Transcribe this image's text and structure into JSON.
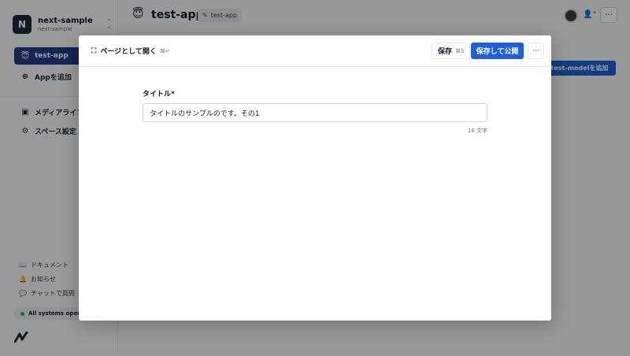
{
  "workspace": {
    "logo_letter": "N",
    "name": "next-sample",
    "subdomain": "next-sample"
  },
  "sidebar": {
    "apps": [
      {
        "label": "test-app",
        "icon": "😇",
        "active": true
      },
      {
        "label": "Appを追加",
        "icon": "⊕"
      }
    ],
    "tools": [
      {
        "label": "メディアライブラリ",
        "icon": "▣"
      },
      {
        "label": "スペース設定",
        "icon": "⚙"
      }
    ],
    "footer": [
      {
        "label": "ドキュメント",
        "icon": "📖"
      },
      {
        "label": "お知らせ",
        "icon": "🔔"
      },
      {
        "label": "チャットで質問",
        "icon": "💬"
      }
    ],
    "status": "All systems operational"
  },
  "topbar": {
    "app_emoji": "😇",
    "app_title": "test-app",
    "endpoint_chip": "test-app",
    "more": "···"
  },
  "background": {
    "add_model_button": "test-modelを追加"
  },
  "modal": {
    "open_as_page": "ページとして開く",
    "open_as_page_shortcut": "⌘↵",
    "save": "保存",
    "save_shortcut": "⌘S",
    "save_publish": "保存して公開",
    "more": "···",
    "field": {
      "label": "タイトル*",
      "value": "タイトルのサンプルのです。その1",
      "char_count": "16 文字"
    }
  },
  "colors": {
    "primary": "#1e5fd6",
    "sidebar_active": "#1f3a8a",
    "status_ok": "#10b981"
  }
}
